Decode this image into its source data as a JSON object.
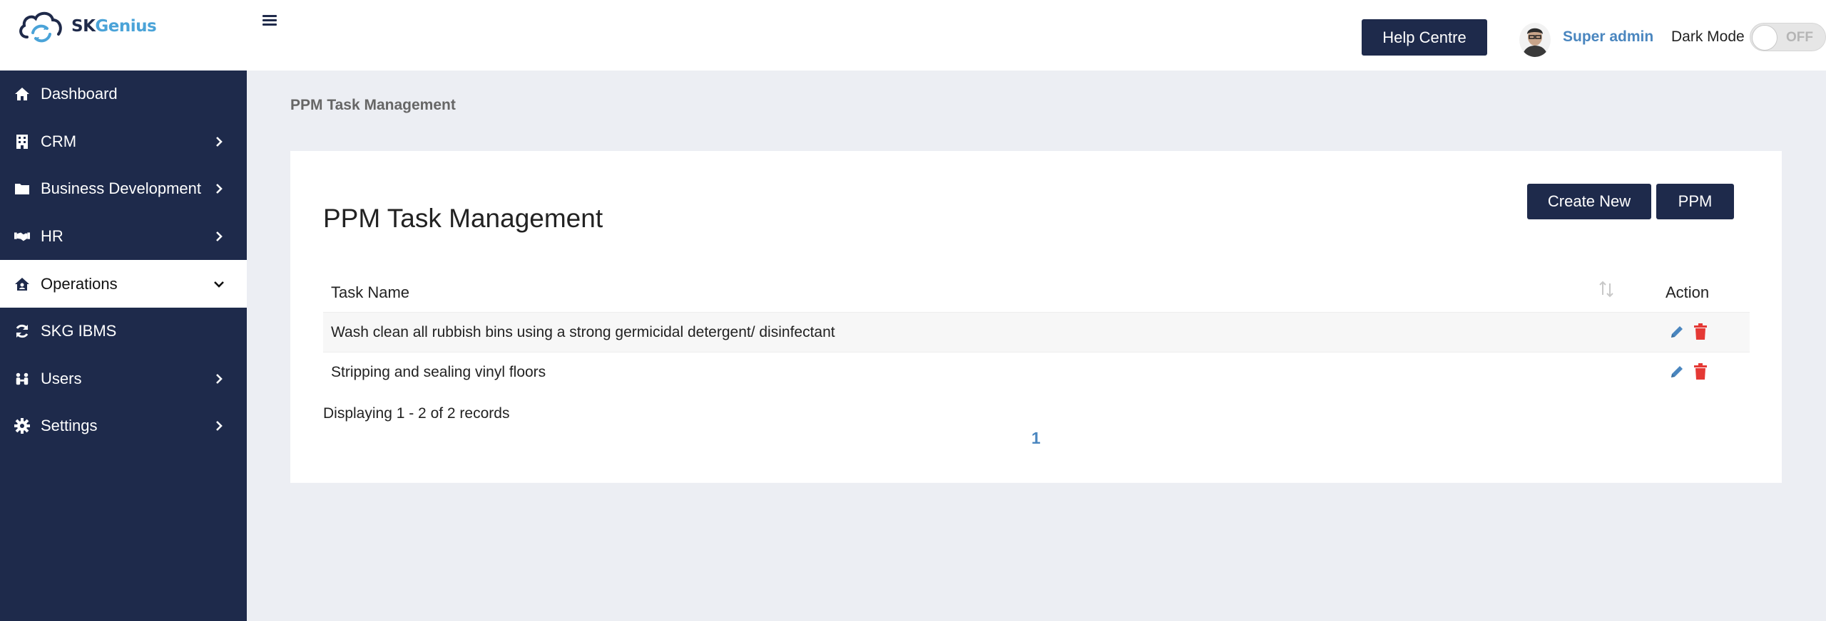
{
  "brand": {
    "name_part1": "SK",
    "name_part2": "Genius"
  },
  "header": {
    "help_label": "Help Centre",
    "user_name": "Super admin",
    "dark_mode_label": "Dark Mode",
    "dark_mode_state": "OFF"
  },
  "sidebar": {
    "items": [
      {
        "label": "Dashboard",
        "icon": "home-icon",
        "has_chevron": false
      },
      {
        "label": "CRM",
        "icon": "building-icon",
        "has_chevron": true
      },
      {
        "label": "Business Development",
        "icon": "folder-icon",
        "has_chevron": true
      },
      {
        "label": "HR",
        "icon": "handshake-icon",
        "has_chevron": true
      },
      {
        "label": "Operations",
        "icon": "house-user-icon",
        "has_chevron": true,
        "active": true
      },
      {
        "label": "SKG IBMS",
        "icon": "sync-icon",
        "has_chevron": false
      },
      {
        "label": "Users",
        "icon": "users-icon",
        "has_chevron": true
      },
      {
        "label": "Settings",
        "icon": "gear-icon",
        "has_chevron": true
      }
    ]
  },
  "breadcrumb": "PPM Task Management",
  "main": {
    "title": "PPM Task Management",
    "create_label": "Create New",
    "ppm_label": "PPM",
    "table": {
      "columns": [
        "Task Name",
        "Action"
      ],
      "rows": [
        {
          "task": "Wash clean all rubbish bins using a strong germicidal detergent/ disinfectant"
        },
        {
          "task": "Stripping and sealing vinyl floors"
        }
      ]
    },
    "records_text": "Displaying 1 - 2 of 2 records",
    "current_page": "1"
  },
  "colors": {
    "navy": "#1e2a4b",
    "link_blue": "#4a86bf",
    "edit_blue": "#4a86bf",
    "delete_red": "#e53935",
    "page_bg": "#eceef3"
  }
}
